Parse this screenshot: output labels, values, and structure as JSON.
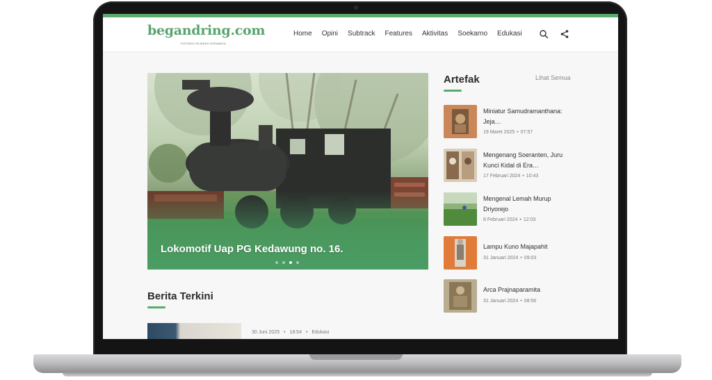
{
  "site": {
    "logo": "begandring.com",
    "tagline": "PUSTAKA SEJARAH SURABAYA",
    "accent_color": "#5aaa70"
  },
  "nav": {
    "items": [
      "Home",
      "Opini",
      "Subtrack",
      "Features",
      "Aktivitas",
      "Soekarno",
      "Edukasi"
    ],
    "search_icon": "search-icon",
    "share_icon": "share-icon"
  },
  "hero": {
    "caption": "Lokomotif Uap PG Kedawung no. 16.",
    "slide_count": 4,
    "active_slide": 3
  },
  "latest": {
    "title": "Berita Terkini",
    "first": {
      "date": "30 Juni 2025",
      "time": "18:54",
      "category": "Edukasi"
    }
  },
  "sidebar": {
    "title": "Artefak",
    "see_all": "Lihat Semua",
    "items": [
      {
        "title": "Miniatur Samudramanthana: Jeja…",
        "date": "19 Maret 2025",
        "time": "07:57"
      },
      {
        "title": "Mengenang Soeranten, Juru Kunci Kidal di Era…",
        "date": "17 Februari 2024",
        "time": "10:43"
      },
      {
        "title": "Mengenal Lemah Murup Driyorejo",
        "date": "8 Februari 2024",
        "time": "12:03"
      },
      {
        "title": "Lampu Kuno Majapahit",
        "date": "31 Januari 2024",
        "time": "09:03"
      },
      {
        "title": "Arca Prajnaparamita",
        "date": "31 Januari 2024",
        "time": "08:56"
      }
    ]
  }
}
